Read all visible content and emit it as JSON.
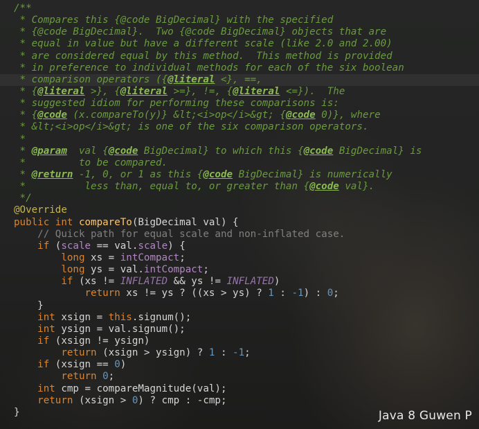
{
  "editor": {
    "lines": [
      {
        "id": "l1",
        "parts": [
          {
            "c": "doc",
            "t": "/**"
          }
        ]
      },
      {
        "id": "l2",
        "parts": [
          {
            "c": "doc",
            "t": " * Compares this {@code BigDecimal} with the specified"
          }
        ]
      },
      {
        "id": "l3",
        "parts": [
          {
            "c": "doc",
            "t": " * {@code BigDecimal}.  Two {@code BigDecimal} objects that are"
          }
        ]
      },
      {
        "id": "l4",
        "parts": [
          {
            "c": "doc",
            "t": " * equal in value but have a different scale (like 2.0 and 2.00)"
          }
        ]
      },
      {
        "id": "l5",
        "parts": [
          {
            "c": "doc",
            "t": " * are considered equal by this method.  This method is provided"
          }
        ]
      },
      {
        "id": "l6",
        "parts": [
          {
            "c": "doc",
            "t": " * in preference to individual methods for each of the six boolean"
          }
        ]
      },
      {
        "id": "l7",
        "highlight": true,
        "parts": [
          {
            "c": "doc",
            "t": " * comparison operators ({"
          },
          {
            "c": "doc-tag",
            "t": "@literal"
          },
          {
            "c": "doc",
            "t": " <}, ==,"
          }
        ]
      },
      {
        "id": "l8",
        "parts": [
          {
            "c": "doc",
            "t": " * {"
          },
          {
            "c": "doc-tag",
            "t": "@literal"
          },
          {
            "c": "doc",
            "t": " >}, {"
          },
          {
            "c": "doc-tag",
            "t": "@literal"
          },
          {
            "c": "doc",
            "t": " >=}, !=, {"
          },
          {
            "c": "doc-tag",
            "t": "@literal"
          },
          {
            "c": "doc",
            "t": " <=}).  The"
          }
        ]
      },
      {
        "id": "l9",
        "parts": [
          {
            "c": "doc",
            "t": " * suggested idiom for performing these comparisons is:"
          }
        ]
      },
      {
        "id": "l10",
        "parts": [
          {
            "c": "doc",
            "t": " * {"
          },
          {
            "c": "doc-tag",
            "t": "@code"
          },
          {
            "c": "doc",
            "t": " (x.compareTo(y)} &lt;<i>op</i>&gt; {"
          },
          {
            "c": "doc-tag",
            "t": "@code"
          },
          {
            "c": "doc",
            "t": " 0)}, where"
          }
        ]
      },
      {
        "id": "l11",
        "parts": [
          {
            "c": "doc",
            "t": " * &lt;<i>op</i>&gt; is one of the six comparison operators."
          }
        ]
      },
      {
        "id": "l12",
        "parts": [
          {
            "c": "doc",
            "t": " *"
          }
        ]
      },
      {
        "id": "l13",
        "parts": [
          {
            "c": "doc",
            "t": " * "
          },
          {
            "c": "doc-tag",
            "t": "@param"
          },
          {
            "c": "doc",
            "t": "  val {"
          },
          {
            "c": "doc-tag",
            "t": "@code"
          },
          {
            "c": "doc",
            "t": " BigDecimal} to which this {"
          },
          {
            "c": "doc-tag",
            "t": "@code"
          },
          {
            "c": "doc",
            "t": " BigDecimal} is"
          }
        ]
      },
      {
        "id": "l14",
        "parts": [
          {
            "c": "doc",
            "t": " *         to be compared."
          }
        ]
      },
      {
        "id": "l15",
        "parts": [
          {
            "c": "doc",
            "t": " * "
          },
          {
            "c": "doc-tag",
            "t": "@return"
          },
          {
            "c": "doc",
            "t": " -1, 0, or 1 as this {"
          },
          {
            "c": "doc-tag",
            "t": "@code"
          },
          {
            "c": "doc",
            "t": " BigDecimal} is numerically"
          }
        ]
      },
      {
        "id": "l16",
        "parts": [
          {
            "c": "doc",
            "t": " *          less than, equal to, or greater than {"
          },
          {
            "c": "doc-tag",
            "t": "@code"
          },
          {
            "c": "doc",
            "t": " val}."
          }
        ]
      },
      {
        "id": "l17",
        "parts": [
          {
            "c": "doc",
            "t": " */"
          }
        ]
      },
      {
        "id": "l18",
        "parts": [
          {
            "c": "ann",
            "t": "@Override"
          }
        ]
      },
      {
        "id": "l19",
        "parts": [
          {
            "c": "kw",
            "t": "public int "
          },
          {
            "c": "fn",
            "t": "compareTo"
          },
          {
            "c": "",
            "t": "(BigDecimal val) {"
          }
        ]
      },
      {
        "id": "l20",
        "parts": [
          {
            "c": "cmt",
            "t": "    // Quick path for equal scale and non-inflated case."
          }
        ]
      },
      {
        "id": "l21",
        "parts": [
          {
            "c": "kw",
            "t": "    if "
          },
          {
            "c": "",
            "t": "("
          },
          {
            "c": "field",
            "t": "scale"
          },
          {
            "c": "",
            "t": " == val."
          },
          {
            "c": "field",
            "t": "scale"
          },
          {
            "c": "",
            "t": ") {"
          }
        ]
      },
      {
        "id": "l22",
        "parts": [
          {
            "c": "kw",
            "t": "        long "
          },
          {
            "c": "",
            "t": "xs = "
          },
          {
            "c": "field",
            "t": "intCompact"
          },
          {
            "c": "",
            "t": ";"
          }
        ]
      },
      {
        "id": "l23",
        "parts": [
          {
            "c": "kw",
            "t": "        long "
          },
          {
            "c": "",
            "t": "ys = val."
          },
          {
            "c": "field",
            "t": "intCompact"
          },
          {
            "c": "",
            "t": ";"
          }
        ]
      },
      {
        "id": "l24",
        "parts": [
          {
            "c": "kw",
            "t": "        if "
          },
          {
            "c": "",
            "t": "(xs != "
          },
          {
            "c": "const",
            "t": "INFLATED"
          },
          {
            "c": "",
            "t": " && ys != "
          },
          {
            "c": "const",
            "t": "INFLATED"
          },
          {
            "c": "",
            "t": ")"
          }
        ]
      },
      {
        "id": "l25",
        "parts": [
          {
            "c": "kw",
            "t": "            return "
          },
          {
            "c": "",
            "t": "xs != ys ? ((xs > ys) ? "
          },
          {
            "c": "num-lit",
            "t": "1"
          },
          {
            "c": "",
            "t": " : "
          },
          {
            "c": "num-lit",
            "t": "-1"
          },
          {
            "c": "",
            "t": ") : "
          },
          {
            "c": "num-lit",
            "t": "0"
          },
          {
            "c": "",
            "t": ";"
          }
        ]
      },
      {
        "id": "l26",
        "parts": [
          {
            "c": "",
            "t": "    }"
          }
        ]
      },
      {
        "id": "l27",
        "parts": [
          {
            "c": "kw",
            "t": "    int "
          },
          {
            "c": "",
            "t": "xsign = "
          },
          {
            "c": "kw",
            "t": "this"
          },
          {
            "c": "",
            "t": ".signum();"
          }
        ]
      },
      {
        "id": "l28",
        "parts": [
          {
            "c": "kw",
            "t": "    int "
          },
          {
            "c": "",
            "t": "ysign = val.signum();"
          }
        ]
      },
      {
        "id": "l29",
        "parts": [
          {
            "c": "kw",
            "t": "    if "
          },
          {
            "c": "",
            "t": "(xsign != ysign)"
          }
        ]
      },
      {
        "id": "l30",
        "parts": [
          {
            "c": "kw",
            "t": "        return "
          },
          {
            "c": "",
            "t": "(xsign > ysign) ? "
          },
          {
            "c": "num-lit",
            "t": "1"
          },
          {
            "c": "",
            "t": " : "
          },
          {
            "c": "num-lit",
            "t": "-1"
          },
          {
            "c": "",
            "t": ";"
          }
        ]
      },
      {
        "id": "l31",
        "parts": [
          {
            "c": "kw",
            "t": "    if "
          },
          {
            "c": "",
            "t": "(xsign == "
          },
          {
            "c": "num-lit",
            "t": "0"
          },
          {
            "c": "",
            "t": ")"
          }
        ]
      },
      {
        "id": "l32",
        "parts": [
          {
            "c": "kw",
            "t": "        return "
          },
          {
            "c": "num-lit",
            "t": "0"
          },
          {
            "c": "",
            "t": ";"
          }
        ]
      },
      {
        "id": "l33",
        "parts": [
          {
            "c": "kw",
            "t": "    int "
          },
          {
            "c": "",
            "t": "cmp = compareMagnitude(val);"
          }
        ]
      },
      {
        "id": "l34",
        "parts": [
          {
            "c": "kw",
            "t": "    return "
          },
          {
            "c": "",
            "t": "(xsign > "
          },
          {
            "c": "num-lit",
            "t": "0"
          },
          {
            "c": "",
            "t": ") ? cmp : -cmp;"
          }
        ]
      },
      {
        "id": "l35",
        "parts": [
          {
            "c": "",
            "t": "}"
          }
        ]
      }
    ]
  },
  "watermark": {
    "text": "Java 8 Guwen P"
  },
  "theme": {
    "background": "#222322",
    "doc_comment": "#6a9b3e",
    "keyword": "#d98532",
    "annotation": "#c6b64a",
    "method": "#ffc66d",
    "field": "#b187c2",
    "number": "#6897bb",
    "line_comment": "#808080"
  }
}
